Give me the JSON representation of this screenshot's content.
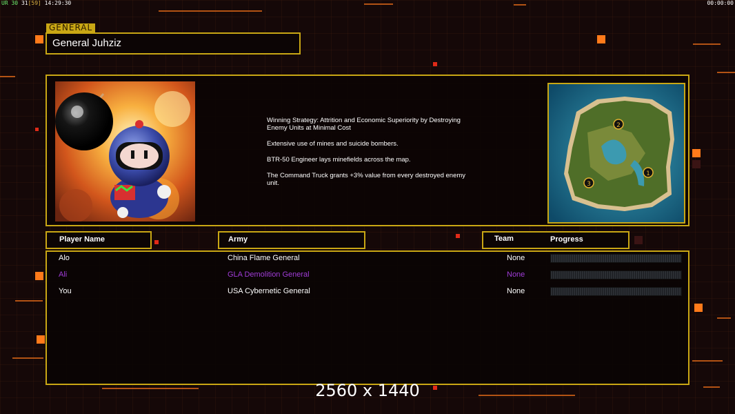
{
  "hud": {
    "fps_label": "UR",
    "fps_a": "30",
    "fps_b": "31",
    "fps_c": "[59]",
    "clock": "14:29:30",
    "timer": "00:00:00"
  },
  "general": {
    "section_tag": "GENERAL",
    "name": "General Juhziz"
  },
  "strategy": {
    "paragraphs": [
      "Winning Strategy: Attrition and Economic Superiority by Destroying\n Enemy Units at Minimal Cost",
      "Extensive use of mines and suicide bombers.",
      "BTR-50 Engineer lays minefields across the map.",
      "The Command Truck grants +3% value from every destroyed enemy\n unit."
    ]
  },
  "minimap": {
    "start_positions": [
      "1",
      "2",
      "3"
    ]
  },
  "table": {
    "headers": {
      "player_name": "Player Name",
      "army": "Army",
      "team": "Team",
      "progress": "Progress"
    },
    "rows": [
      {
        "name": "Alo",
        "army": "China Flame General",
        "team": "None",
        "color": "#ffffff",
        "progress": 0
      },
      {
        "name": "Ali",
        "army": "GLA Demolition General",
        "team": "None",
        "color": "#a03cd8",
        "progress": 0
      },
      {
        "name": "You",
        "army": "USA Cybernetic General",
        "team": "None",
        "color": "#ffffff",
        "progress": 0
      }
    ]
  },
  "footer": {
    "resolution": "2560 x 1440"
  },
  "colors": {
    "frame_gold": "#c9a714",
    "accent_orange": "#ff7a1a",
    "background": "#150808"
  }
}
